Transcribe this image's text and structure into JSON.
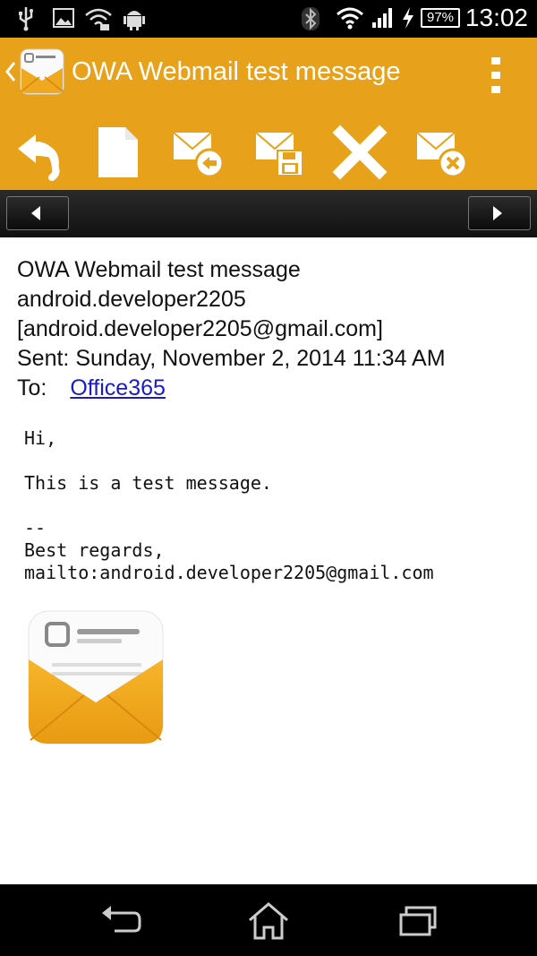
{
  "status_bar": {
    "battery": "97%",
    "time": "13:02"
  },
  "action_bar": {
    "title": "OWA Webmail test message"
  },
  "toolbar": {
    "items": [
      {
        "name": "reply-icon"
      },
      {
        "name": "new-document-icon"
      },
      {
        "name": "mail-reply-icon"
      },
      {
        "name": "mail-save-icon"
      },
      {
        "name": "delete-icon"
      },
      {
        "name": "mail-delete-icon"
      }
    ]
  },
  "message": {
    "subject": "OWA Webmail test message",
    "from_name": "android.developer2205",
    "from_email": "[android.developer2205@gmail.com]",
    "sent_label": "Sent:",
    "sent_value": "Sunday, November 2, 2014 11:34 AM",
    "to_label": "To:",
    "to_value": "Office365",
    "body": "Hi,\n\nThis is a test message.\n\n--\nBest regards,\nmailto:android.developer2205@gmail.com"
  },
  "colors": {
    "accent": "#e8a11a",
    "link": "#1a1acc"
  }
}
